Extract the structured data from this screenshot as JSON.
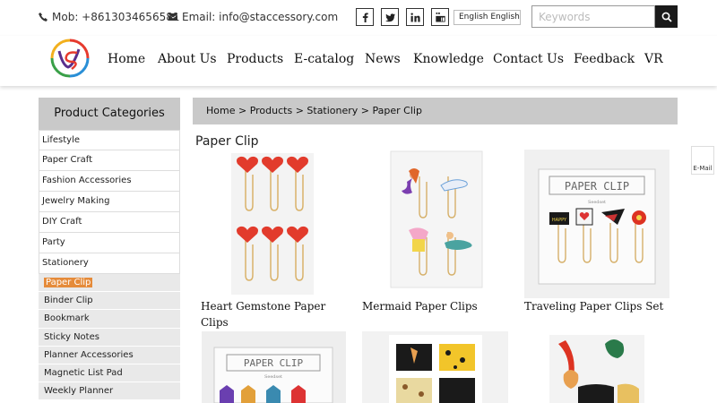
{
  "topbar": {
    "mobile_label": "Mob: +8613034656581",
    "email_label": "Email: info@staccessory.com",
    "social": [
      "facebook-icon",
      "twitter-icon",
      "linkedin-icon",
      "youtube-icon"
    ],
    "language": "English  English",
    "search_placeholder": "Keywords"
  },
  "nav": {
    "items": [
      "Home",
      "About Us",
      "Products",
      "E-catalog",
      "News",
      "Knowledge",
      "Contact Us",
      "Feedback",
      "VR"
    ]
  },
  "sidebar": {
    "title": "Product Categories",
    "items": [
      "Lifestyle",
      "Paper Craft",
      "Fashion Accessories",
      "Jewelry Making",
      "DIY Craft",
      "Party",
      "Stationery"
    ],
    "subitems": [
      "Paper Clip",
      "Binder Clip",
      "Bookmark",
      "Sticky Notes",
      "Planner Accessories",
      "Magnetic List Pad",
      "Weekly Planner"
    ]
  },
  "breadcrumb": "Home > Products > Stationery > Paper Clip",
  "page_title": "Paper Clip",
  "products": [
    {
      "name": "Heart Gemstone Paper Clips"
    },
    {
      "name": "Mermaid Paper Clips"
    },
    {
      "name": "Traveling Paper Clips Set"
    },
    {
      "name": ""
    },
    {
      "name": ""
    },
    {
      "name": ""
    }
  ],
  "product_text": {
    "card_label": "PAPER CLIP",
    "brand_mark": "Seedset",
    "mini_card_text": "HAPPY"
  },
  "email_tab": "E-Mail",
  "colors": {
    "accent": "#e58b3a",
    "header_bg": "#c9c9c9"
  }
}
